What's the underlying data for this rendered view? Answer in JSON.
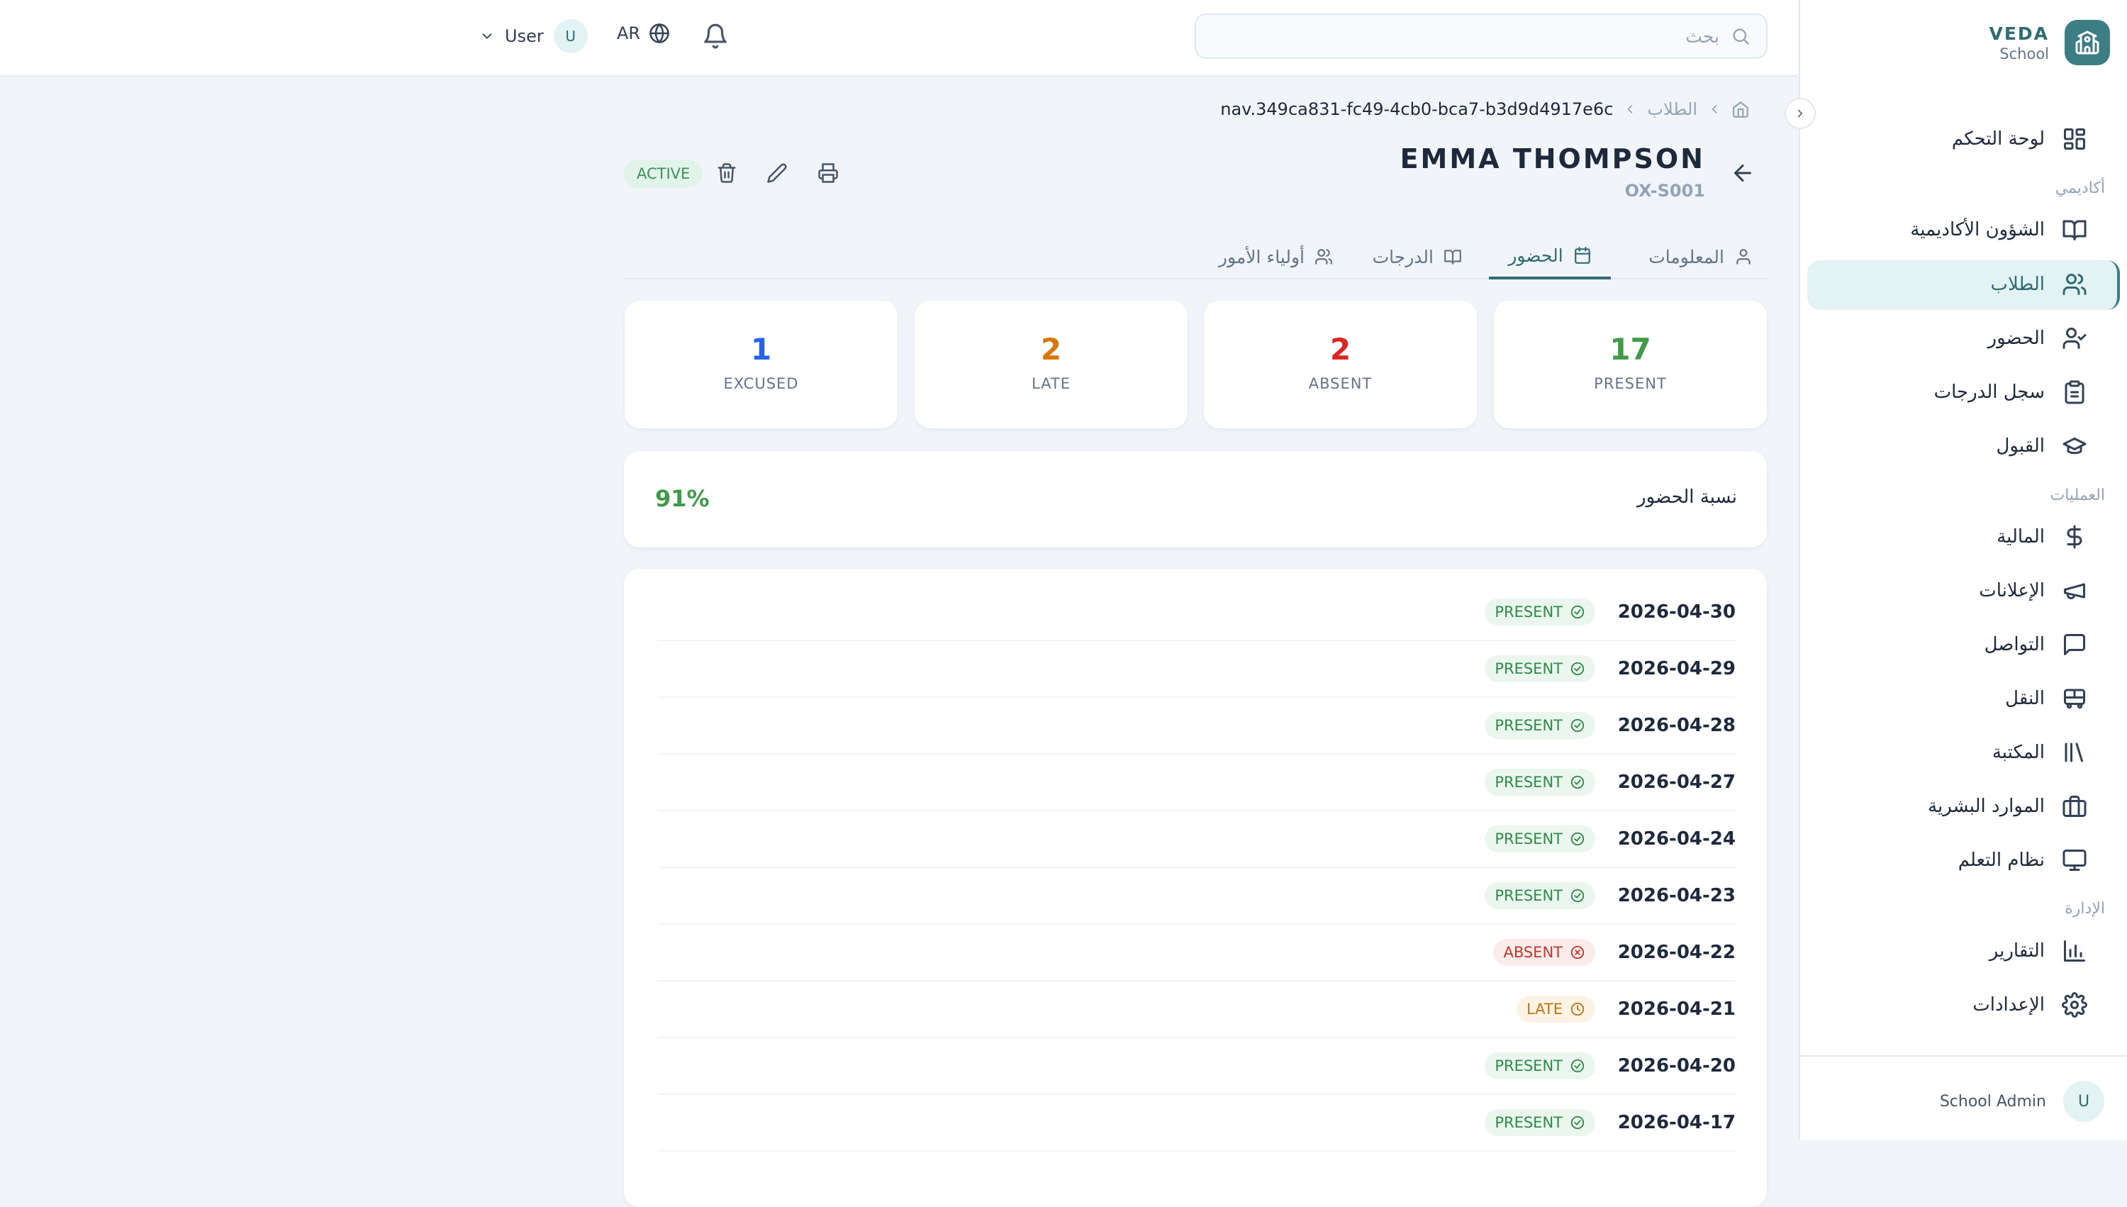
{
  "brand": {
    "name": "VEDA",
    "subtitle": "School"
  },
  "sidebar": {
    "items": [
      {
        "label": "لوحة التحكم",
        "icon": "dashboard-icon"
      },
      {
        "section": "أكاديمي"
      },
      {
        "label": "الشؤون الأكاديمية",
        "icon": "book-open-icon"
      },
      {
        "label": "الطلاب",
        "icon": "users-icon",
        "active": true
      },
      {
        "label": "الحضور",
        "icon": "user-check-icon"
      },
      {
        "label": "سجل الدرجات",
        "icon": "clipboard-icon"
      },
      {
        "label": "القبول",
        "icon": "graduation-cap-icon"
      },
      {
        "section": "العمليات"
      },
      {
        "label": "المالية",
        "icon": "dollar-icon"
      },
      {
        "label": "الإعلانات",
        "icon": "megaphone-icon"
      },
      {
        "label": "التواصل",
        "icon": "message-icon"
      },
      {
        "label": "النقل",
        "icon": "bus-icon"
      },
      {
        "label": "المكتبة",
        "icon": "library-icon"
      },
      {
        "label": "الموارد البشرية",
        "icon": "briefcase-icon"
      },
      {
        "label": "نظام التعلم",
        "icon": "monitor-icon"
      },
      {
        "section": "الإدارة"
      },
      {
        "label": "التقارير",
        "icon": "bar-chart-icon"
      },
      {
        "label": "الإعدادات",
        "icon": "settings-icon"
      }
    ],
    "footer_user": {
      "name": "School Admin",
      "initial": "U"
    }
  },
  "topbar": {
    "search_placeholder": "بحث",
    "language": "AR",
    "user_name": "User",
    "user_initial": "U"
  },
  "breadcrumb": {
    "section": "الطلاب",
    "current": "nav.349ca831-fc49-4cb0-bca7-b3d9d4917e6c"
  },
  "student": {
    "name": "EMMA THOMPSON",
    "id": "OX-S001",
    "status": "ACTIVE"
  },
  "tabs": [
    {
      "label": "المعلومات",
      "icon": "user-icon"
    },
    {
      "label": "الحضور",
      "icon": "calendar-icon",
      "active": true
    },
    {
      "label": "الدرجات",
      "icon": "book-icon"
    },
    {
      "label": "أولياء الأمور",
      "icon": "users-icon"
    }
  ],
  "stats": [
    {
      "value": "17",
      "label": "PRESENT",
      "color": "#3f9b4a"
    },
    {
      "value": "2",
      "label": "ABSENT",
      "color": "#dc2626"
    },
    {
      "value": "2",
      "label": "LATE",
      "color": "#d97706"
    },
    {
      "value": "1",
      "label": "EXCUSED",
      "color": "#2563eb"
    }
  ],
  "attendance_rate": {
    "label": "نسبة الحضور",
    "value": "91%"
  },
  "records": [
    {
      "date": "2026-04-30",
      "status": "PRESENT"
    },
    {
      "date": "2026-04-29",
      "status": "PRESENT"
    },
    {
      "date": "2026-04-28",
      "status": "PRESENT"
    },
    {
      "date": "2026-04-27",
      "status": "PRESENT"
    },
    {
      "date": "2026-04-24",
      "status": "PRESENT"
    },
    {
      "date": "2026-04-23",
      "status": "PRESENT"
    },
    {
      "date": "2026-04-22",
      "status": "ABSENT"
    },
    {
      "date": "2026-04-21",
      "status": "LATE"
    },
    {
      "date": "2026-04-20",
      "status": "PRESENT"
    },
    {
      "date": "2026-04-17",
      "status": "PRESENT"
    }
  ]
}
